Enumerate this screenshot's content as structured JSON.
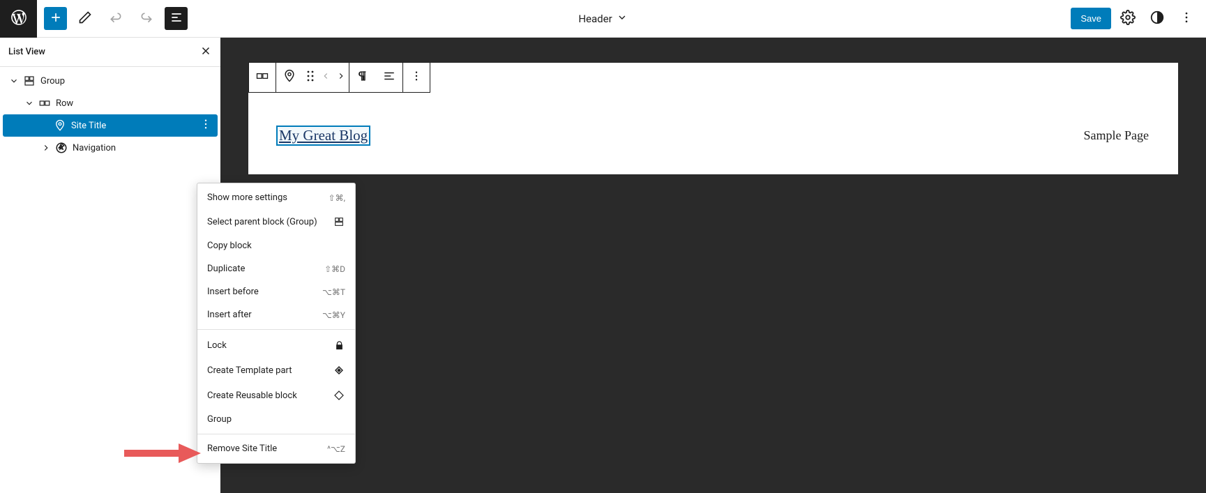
{
  "topbar": {
    "template_name": "Header",
    "save_label": "Save"
  },
  "sidebar": {
    "title": "List View",
    "tree": {
      "group_label": "Group",
      "row_label": "Row",
      "site_title_label": "Site Title",
      "navigation_label": "Navigation"
    }
  },
  "context_menu": {
    "show_more": {
      "label": "Show more settings",
      "shortcut": "⇧⌘,"
    },
    "select_parent": {
      "label": "Select parent block (Group)"
    },
    "copy": {
      "label": "Copy block"
    },
    "duplicate": {
      "label": "Duplicate",
      "shortcut": "⇧⌘D"
    },
    "insert_before": {
      "label": "Insert before",
      "shortcut": "⌥⌘T"
    },
    "insert_after": {
      "label": "Insert after",
      "shortcut": "⌥⌘Y"
    },
    "lock": {
      "label": "Lock"
    },
    "create_template": {
      "label": "Create Template part"
    },
    "create_reusable": {
      "label": "Create Reusable block"
    },
    "group": {
      "label": "Group"
    },
    "remove": {
      "label": "Remove Site Title",
      "shortcut": "^⌥Z"
    }
  },
  "canvas": {
    "site_title": "My Great Blog",
    "sample_page": "Sample Page"
  }
}
